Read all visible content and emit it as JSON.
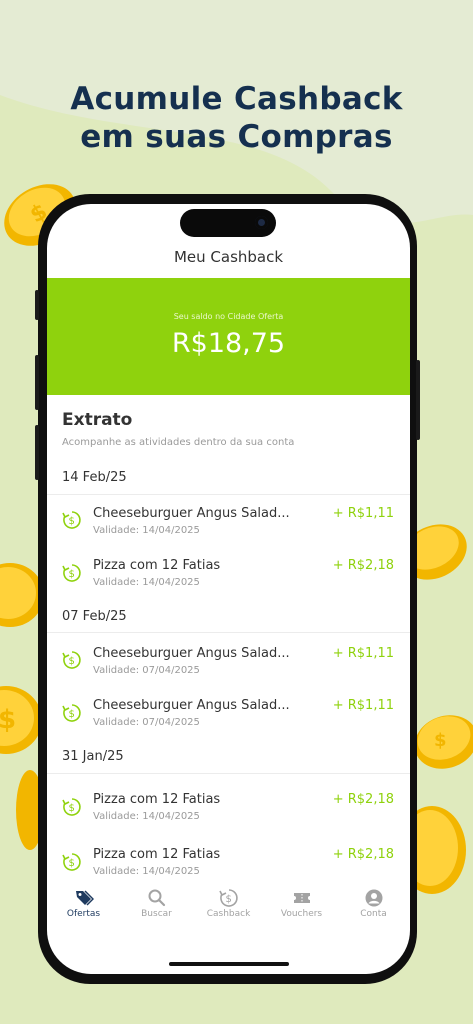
{
  "promo": {
    "headline_line1": "Acumule Cashback",
    "headline_line2": "em suas Compras"
  },
  "colors": {
    "accent": "#8fd20d",
    "headline": "#15304f",
    "background": "#e6ecd6"
  },
  "header": {
    "title": "Meu Cashback"
  },
  "balance": {
    "label": "Seu saldo no Cidade Oferta",
    "value": "R$18,75"
  },
  "statement": {
    "title": "Extrato",
    "subtitle": "Acompanhe as atividades dentro da sua conta",
    "groups": [
      {
        "date": "14 Feb/25",
        "items": [
          {
            "name": "Cheeseburguer Angus Salad...",
            "validity": "Validade: 14/04/2025",
            "amount": "+ R$1,11"
          },
          {
            "name": "Pizza com 12 Fatias",
            "validity": "Validade: 14/04/2025",
            "amount": "+ R$2,18"
          }
        ]
      },
      {
        "date": "07 Feb/25",
        "items": [
          {
            "name": "Cheeseburguer Angus Salad...",
            "validity": "Validade: 07/04/2025",
            "amount": "+ R$1,11"
          },
          {
            "name": "Cheeseburguer Angus Salad...",
            "validity": "Validade: 07/04/2025",
            "amount": "+ R$1,11"
          }
        ]
      },
      {
        "date": "31 Jan/25",
        "items": [
          {
            "name": "Pizza com 12 Fatias",
            "validity": "Validade: 14/04/2025",
            "amount": "+ R$2,18"
          },
          {
            "name": "Pizza com 12 Fatias",
            "validity": "Validade: 14/04/2025",
            "amount": "+ R$2,18"
          }
        ]
      }
    ]
  },
  "tabbar": {
    "tabs": [
      {
        "label": "Ofertas",
        "icon": "tag-icon",
        "active": true
      },
      {
        "label": "Buscar",
        "icon": "search-icon",
        "active": false
      },
      {
        "label": "Cashback",
        "icon": "cashback-icon",
        "active": false
      },
      {
        "label": "Vouchers",
        "icon": "ticket-icon",
        "active": false
      },
      {
        "label": "Conta",
        "icon": "user-icon",
        "active": false
      }
    ]
  }
}
